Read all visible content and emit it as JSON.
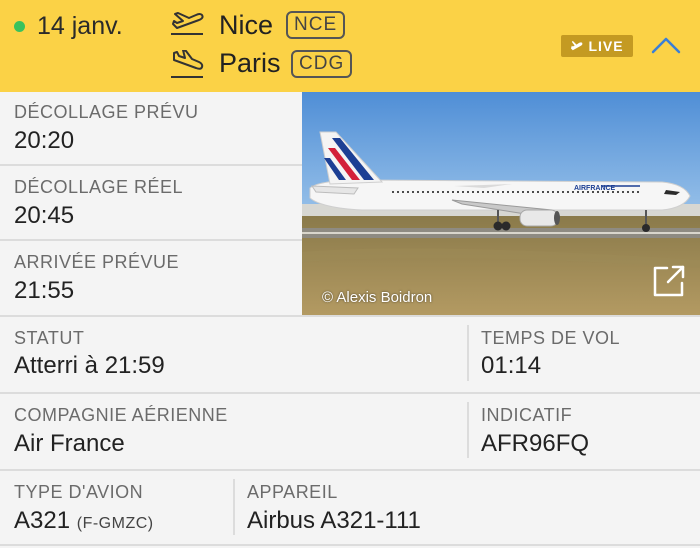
{
  "header": {
    "date": "14 janv.",
    "departure_city": "Nice",
    "departure_code": "NCE",
    "arrival_city": "Paris",
    "arrival_code": "CDG",
    "live_label": "LIVE",
    "status_dot_color": "#39c25d",
    "background_color": "#fbd246"
  },
  "times": {
    "scheduled_departure_label": "DÉCOLLAGE PRÉVU",
    "scheduled_departure": "20:20",
    "actual_departure_label": "DÉCOLLAGE RÉEL",
    "actual_departure": "20:45",
    "scheduled_arrival_label": "ARRIVÉE PRÉVUE",
    "scheduled_arrival": "21:55"
  },
  "photo": {
    "credit": "© Alexis Boidron",
    "livery_text": "AIRFRANCE"
  },
  "details": {
    "status_label": "STATUT",
    "status": "Atterri à 21:59",
    "flight_time_label": "TEMPS DE VOL",
    "flight_time": "01:14",
    "airline_label": "COMPAGNIE AÉRIENNE",
    "airline": "Air France",
    "callsign_label": "INDICATIF",
    "callsign": "AFR96FQ",
    "aircraft_type_label": "TYPE D'AVION",
    "aircraft_type": "A321",
    "registration": "(F-GMZC)",
    "aircraft_label": "APPAREIL",
    "aircraft": "Airbus A321-111"
  }
}
